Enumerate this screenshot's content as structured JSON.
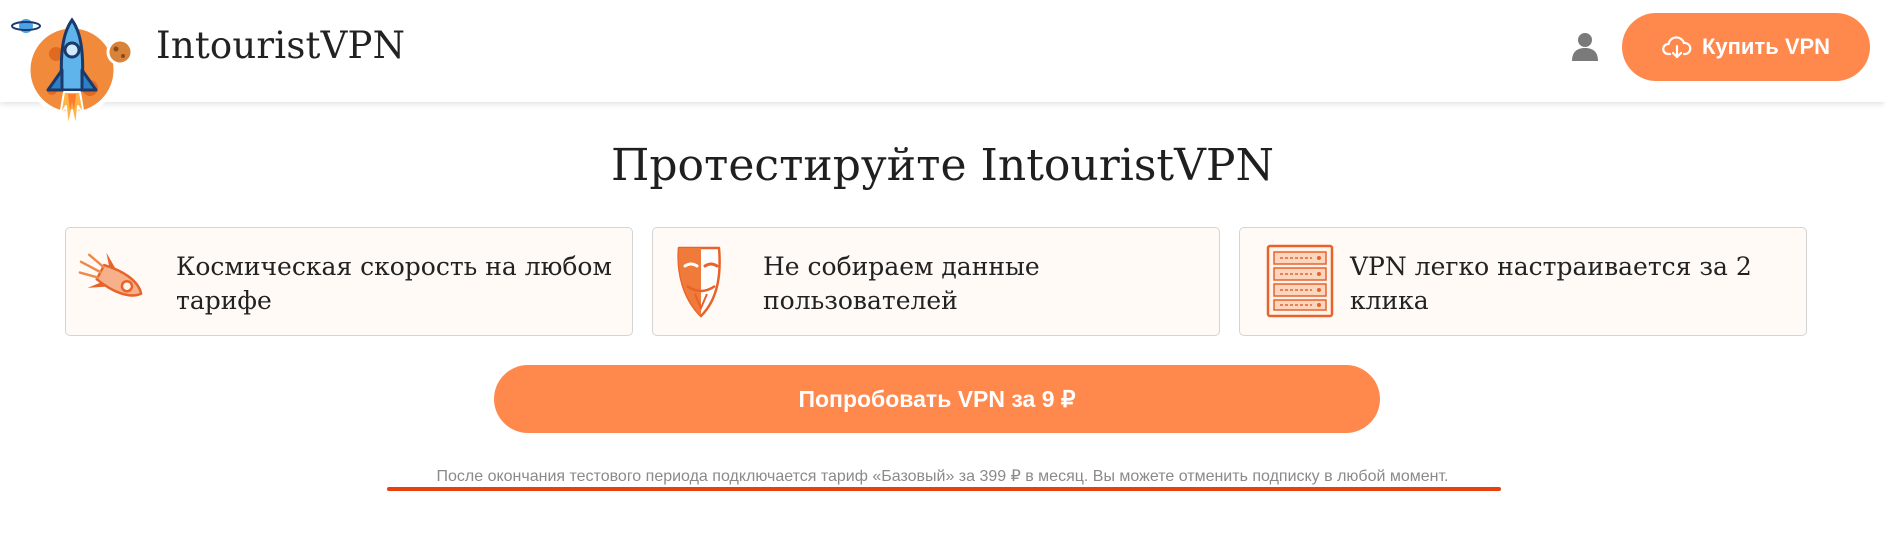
{
  "header": {
    "brand": "IntouristVPN",
    "buy_button_label": "Купить VPN"
  },
  "icons": {
    "logo": "rocket-mascot-logo-icon",
    "user": "user-icon",
    "cloud": "cloud-download-icon",
    "feature_1": "rocket-icon",
    "feature_2": "anonymous-mask-icon",
    "feature_3": "server-rack-icon"
  },
  "main": {
    "title": "Протестируйте IntouristVPN",
    "features": [
      {
        "text": "Космическая скорость на любом тарифе"
      },
      {
        "text": "Не собираем данные пользователей"
      },
      {
        "text": "VPN легко настраивается за 2 клика"
      }
    ],
    "try_button_label": "Попробовать VPN за 9 ₽",
    "disclaimer": "После окончания тестового периода подключается тариф «Базовый» за 399 ₽ в месяц. Вы можете отменить подписку в любой момент."
  },
  "colors": {
    "accent": "#ff884d",
    "highlight_underline": "#e8410d",
    "card_bg": "#fffaf6"
  }
}
